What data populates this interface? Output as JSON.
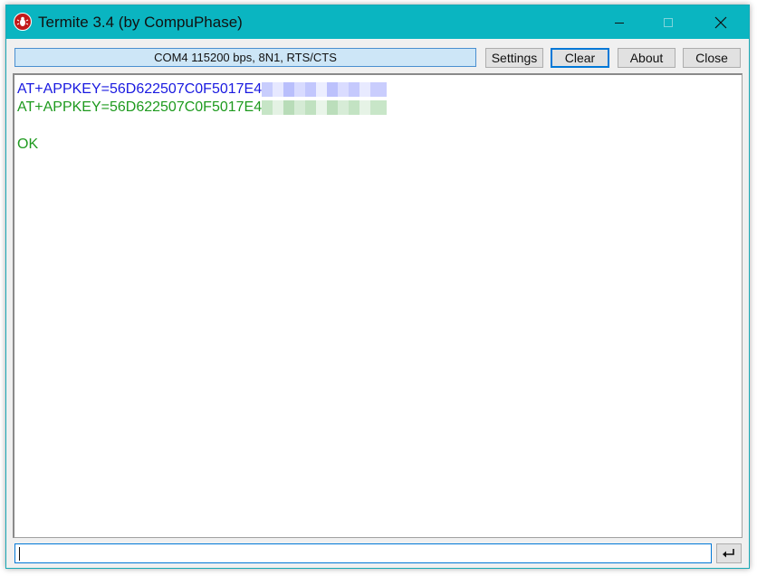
{
  "window": {
    "title": "Termite 3.4 (by CompuPhase)",
    "accent_color": "#0ab5c1"
  },
  "toolbar": {
    "connection_status": "COM4 115200 bps, 8N1, RTS/CTS",
    "settings_label": "Settings",
    "clear_label": "Clear",
    "about_label": "About",
    "close_label": "Close"
  },
  "terminal": {
    "sent_line": "AT+APPKEY=56D622507C0F5017E4",
    "echo_line": "AT+APPKEY=56D622507C0F5017E4",
    "response": "OK",
    "sent_color": "#1a1ae0",
    "received_color": "#1e9a1e"
  },
  "input": {
    "value": ""
  },
  "icons": {
    "app": "termite-bug-icon",
    "minimize": "minimize-icon",
    "maximize": "maximize-icon",
    "close": "close-icon",
    "send": "enter-return-icon"
  }
}
